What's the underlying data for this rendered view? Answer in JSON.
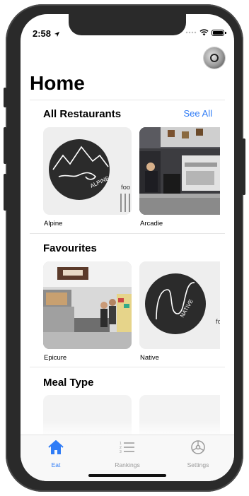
{
  "status_bar": {
    "time": "2:58"
  },
  "page": {
    "title": "Home"
  },
  "sections": {
    "all_restaurants": {
      "title": "All Restaurants",
      "see_all": "See All",
      "cards": [
        {
          "label": "Alpine",
          "logo_text": "ALPINE",
          "side_text": "foo"
        },
        {
          "label": "Arcadie"
        }
      ]
    },
    "favourites": {
      "title": "Favourites",
      "cards": [
        {
          "label": "Epicure"
        },
        {
          "label": "Native",
          "logo_text": "NATIVE",
          "side_text": "fo"
        }
      ]
    },
    "meal_type": {
      "title": "Meal Type"
    }
  },
  "tabbar": {
    "tabs": [
      {
        "label": "Eat",
        "icon": "home-icon",
        "active": true
      },
      {
        "label": "Rankings",
        "icon": "list-icon",
        "active": false
      },
      {
        "label": "Settings",
        "icon": "gear-icon",
        "active": false
      }
    ]
  },
  "colors": {
    "accent": "#2f7cf6",
    "inactive": "#999999",
    "logo": "#2b2b2b"
  }
}
